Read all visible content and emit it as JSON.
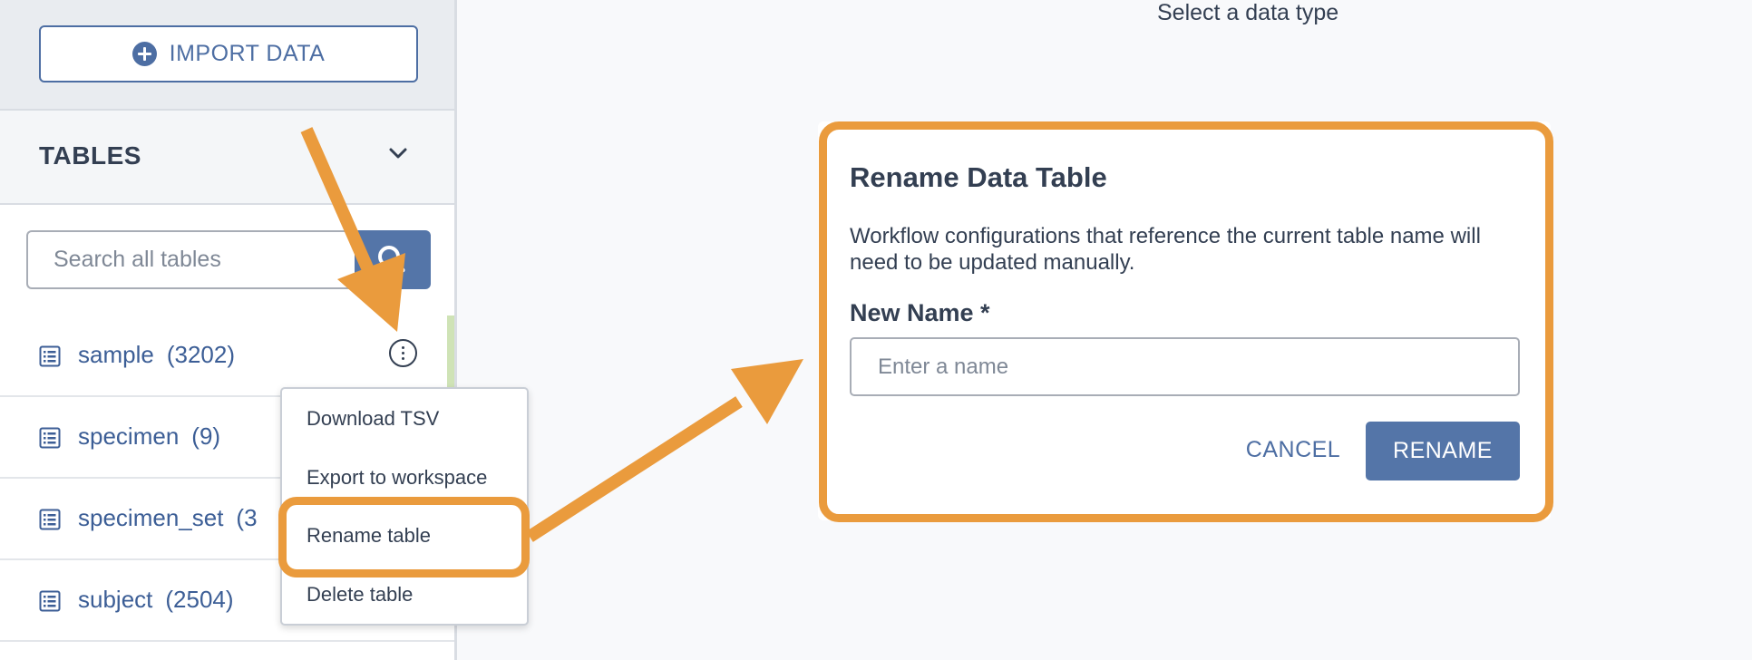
{
  "sidebar": {
    "import_label": "IMPORT DATA",
    "tables_title": "TABLES",
    "search_placeholder": "Search all tables",
    "tables": [
      {
        "name": "sample",
        "count": "(3202)"
      },
      {
        "name": "specimen",
        "count": "(9)"
      },
      {
        "name": "specimen_set",
        "count": "(3"
      },
      {
        "name": "subject",
        "count": "(2504)"
      }
    ]
  },
  "context_menu": {
    "items": [
      "Download TSV",
      "Export to workspace",
      "Rename table",
      "Delete table"
    ]
  },
  "main": {
    "caption": "Select a data type"
  },
  "dialog": {
    "title": "Rename Data Table",
    "description": "Workflow configurations that reference the current table name will need to be updated manually.",
    "field_label": "New Name *",
    "field_placeholder": "Enter a name",
    "field_value": "",
    "cancel_label": "CANCEL",
    "rename_label": "RENAME"
  },
  "colors": {
    "accent": "#4d6ea3",
    "primary_button": "#5475a8",
    "annotation": "#ea9b3d"
  },
  "icons": [
    "plus-circle-icon",
    "chevron-down-icon",
    "search-icon",
    "table-list-icon",
    "kebab-menu-icon"
  ]
}
